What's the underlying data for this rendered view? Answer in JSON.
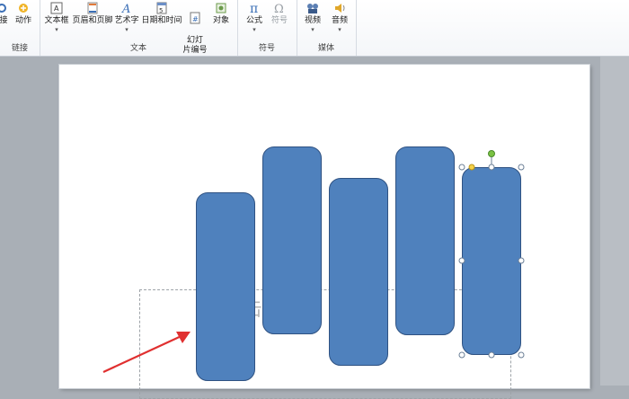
{
  "ribbon": {
    "groups": [
      {
        "label": "链接",
        "buttons": [
          {
            "label": "接"
          },
          {
            "label": "动作"
          }
        ]
      },
      {
        "label": "文本",
        "buttons": [
          {
            "label": "文本框"
          },
          {
            "label": "页眉和页脚"
          },
          {
            "label": "艺术字"
          },
          {
            "label": "日期和时间"
          },
          {
            "label": "幻灯\n片编号"
          },
          {
            "label": "对象"
          }
        ]
      },
      {
        "label": "符号",
        "buttons": [
          {
            "label": "公式"
          },
          {
            "label": "符号"
          }
        ]
      },
      {
        "label": "媒体",
        "buttons": [
          {
            "label": "视频"
          },
          {
            "label": "音频"
          }
        ]
      }
    ]
  },
  "slide": {
    "placeholder_chars": "击添标"
  },
  "colors": {
    "shape_fill": "#4f81bd",
    "shape_border": "#2f5282",
    "arrow": "#e03030",
    "rotate_handle": "#7ac143"
  }
}
